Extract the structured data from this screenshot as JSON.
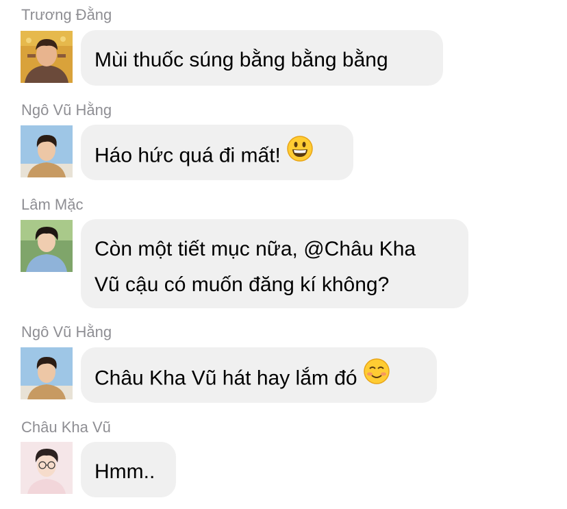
{
  "messages": [
    {
      "sender": "Trương Đằng",
      "avatar_icon": "avatar-truong-dang",
      "lines": [
        "Mùi thuốc súng bằng bằng bằng"
      ],
      "emoji": null
    },
    {
      "sender": "Ngô Vũ Hằng",
      "avatar_icon": "avatar-ngo-vu-hang",
      "lines": [
        "Háo hức quá đi mất!"
      ],
      "emoji": "grinning-face-icon"
    },
    {
      "sender": "Lâm Mặc",
      "avatar_icon": "avatar-lam-mac",
      "lines": [
        "Còn một tiết mục nữa, @Châu Kha",
        "Vũ cậu có muốn đăng kí không?"
      ],
      "emoji": null
    },
    {
      "sender": "Ngô Vũ Hằng",
      "avatar_icon": "avatar-ngo-vu-hang",
      "lines": [
        "Châu Kha Vũ hát hay lắm đó"
      ],
      "emoji": "smiling-face-icon"
    },
    {
      "sender": "Châu Kha Vũ",
      "avatar_icon": "avatar-chau-kha-vu",
      "lines": [
        "Hmm.."
      ],
      "emoji": null
    }
  ],
  "colors": {
    "background": "#ffffff",
    "bubble": "#f0f0f0",
    "sender_text": "#8e8e93",
    "message_text": "#000000"
  }
}
